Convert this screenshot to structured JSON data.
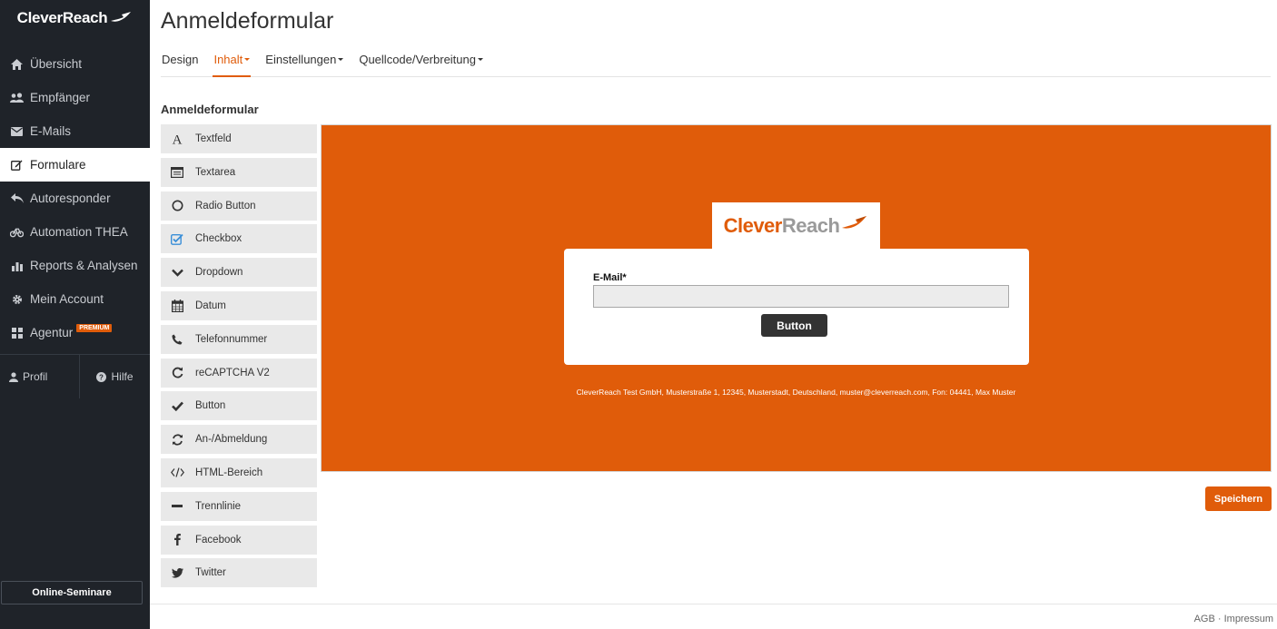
{
  "sidebar": {
    "logo_text": "CleverReach",
    "items": [
      {
        "label": "Übersicht",
        "icon": "home-icon"
      },
      {
        "label": "Empfänger",
        "icon": "users-icon"
      },
      {
        "label": "E-Mails",
        "icon": "envelope-icon"
      },
      {
        "label": "Formulare",
        "icon": "edit-icon"
      },
      {
        "label": "Autoresponder",
        "icon": "reply-icon"
      },
      {
        "label": "Automation THEA",
        "icon": "bicycle-icon"
      },
      {
        "label": "Reports & Analysen",
        "icon": "bar-chart-icon"
      },
      {
        "label": "Mein Account",
        "icon": "gear-icon"
      },
      {
        "label": "Agentur",
        "icon": "grid-icon",
        "badge": "PREMIUM"
      }
    ],
    "active_item": "Formulare",
    "profile_label": "Profil",
    "help_label": "Hilfe",
    "seminar_button": "Online-Seminare"
  },
  "main": {
    "title": "Anmeldeformular",
    "tabs": [
      {
        "label": "Design",
        "dropdown": false
      },
      {
        "label": "Inhalt",
        "dropdown": true
      },
      {
        "label": "Einstellungen",
        "dropdown": true
      },
      {
        "label": "Quellcode/Verbreitung",
        "dropdown": true
      }
    ],
    "active_tab": "Inhalt",
    "section_title": "Anmeldeformular",
    "elements": [
      {
        "label": "Textfeld",
        "icon": "font-icon"
      },
      {
        "label": "Textarea",
        "icon": "textarea-icon"
      },
      {
        "label": "Radio Button",
        "icon": "radio-icon"
      },
      {
        "label": "Checkbox",
        "icon": "checkbox-icon"
      },
      {
        "label": "Dropdown",
        "icon": "chevron-down-icon"
      },
      {
        "label": "Datum",
        "icon": "calendar-icon"
      },
      {
        "label": "Telefonnummer",
        "icon": "phone-icon"
      },
      {
        "label": "reCAPTCHA V2",
        "icon": "refresh-icon"
      },
      {
        "label": "Button",
        "icon": "check-icon"
      },
      {
        "label": "An-/Abmeldung",
        "icon": "sync-icon"
      },
      {
        "label": "HTML-Bereich",
        "icon": "code-icon"
      },
      {
        "label": "Trennlinie",
        "icon": "minus-icon"
      },
      {
        "label": "Facebook",
        "icon": "facebook-icon"
      },
      {
        "label": "Twitter",
        "icon": "twitter-icon"
      }
    ],
    "preview": {
      "background_color": "#e05c0a",
      "logo_text_part1": "Clever",
      "logo_text_part2": "Reach",
      "email_label": "E-Mail*",
      "email_value": "",
      "button_label": "Button",
      "imprint": "CleverReach Test GmbH, Musterstraße 1, 12345, Musterstadt, Deutschland, muster@cleverreach.com, Fon: 04441, Max Muster"
    },
    "save_button": "Speichern"
  },
  "footer": {
    "agb": "AGB",
    "separator": "·",
    "impressum": "Impressum"
  },
  "colors": {
    "accent": "#e05c0a",
    "sidebar_bg": "#1f2329"
  }
}
